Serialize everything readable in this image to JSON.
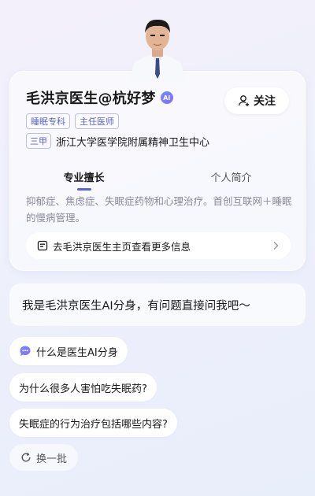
{
  "doctor": {
    "name": "毛洪京医生@杭好梦",
    "ai_badge": "AI",
    "follow_label": "关注",
    "tags": [
      "睡眠专科",
      "主任医师"
    ],
    "hospital_grade": "三甲",
    "hospital": "浙江大学医学院附属精神卫生中心"
  },
  "tabs": [
    {
      "label": "专业擅长",
      "active": true
    },
    {
      "label": "个人简介",
      "active": false
    }
  ],
  "specialty_text": "抑郁症、焦虑症、失眠症药物和心理治疗。首创互联网＋睡眠的慢病管理。",
  "homepage_link": "去毛洪京医生主页查看更多信息",
  "greeting": "我是毛洪京医生AI分身，有问题直接问我吧～",
  "questions": [
    "什么是医生AI分身",
    "为什么很多人害怕吃失眠药?",
    "失眠症的行为治疗包括哪些内容?"
  ],
  "refresh_label": "换一批",
  "colors": {
    "accent": "#5b63d6",
    "muted_text": "#8a8a9a"
  }
}
